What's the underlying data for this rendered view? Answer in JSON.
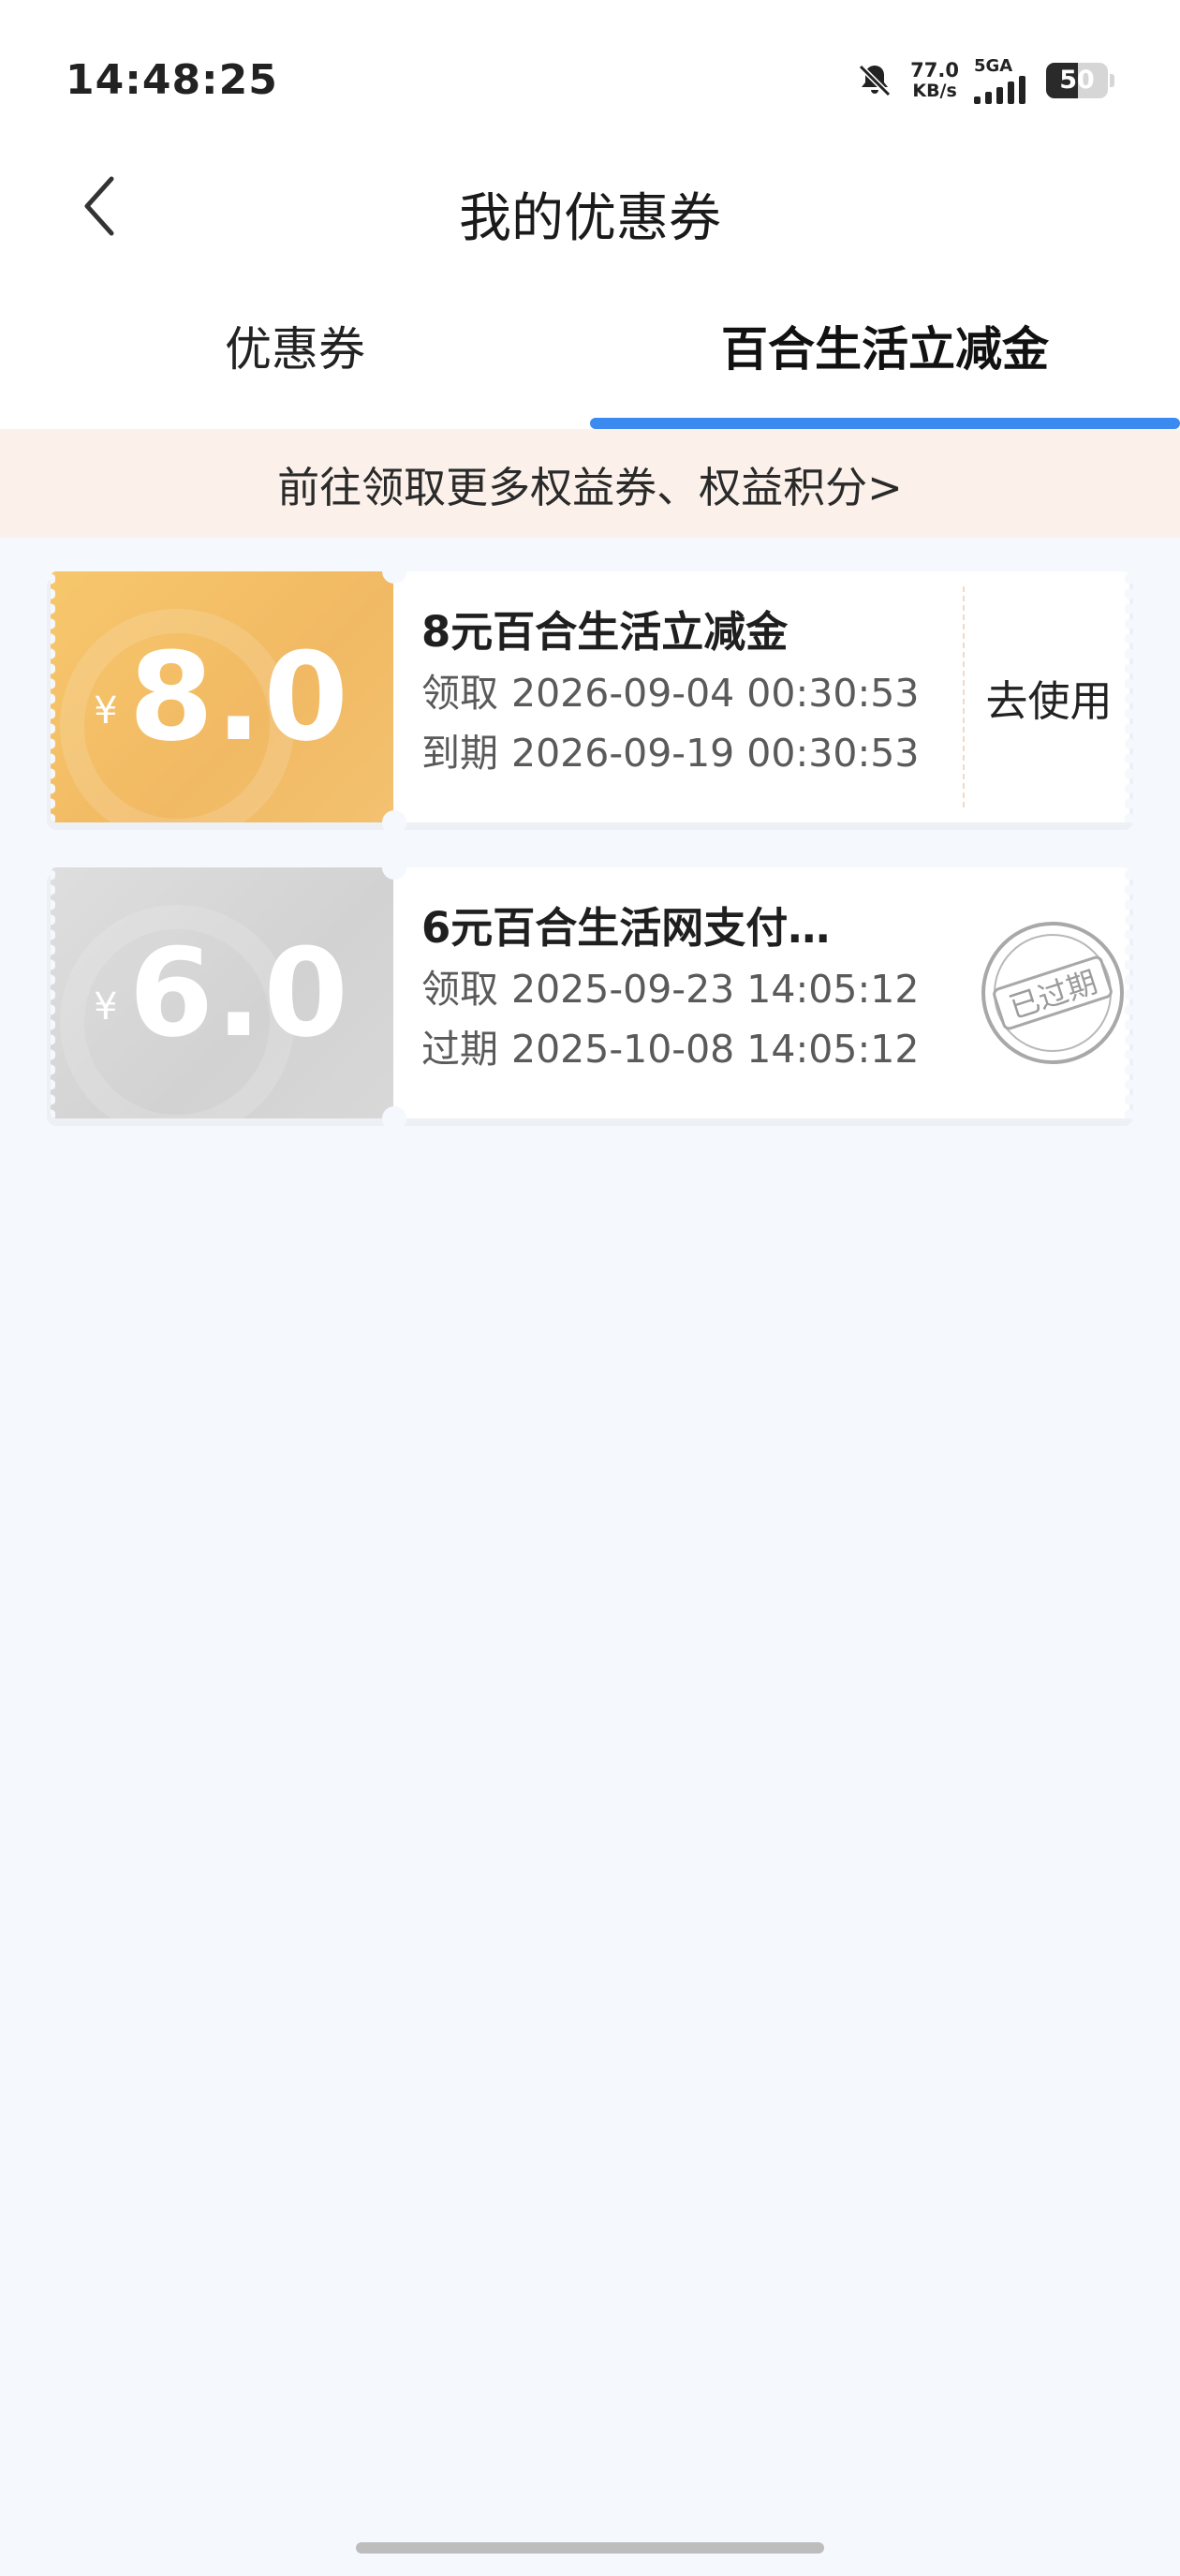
{
  "status_bar": {
    "time": "14:48:25",
    "net_speed_value": "77.0",
    "net_speed_unit": "KB/s",
    "network_type": "5GA",
    "battery_level": "50",
    "icons": [
      "bell-muted-icon",
      "signal-icon",
      "battery-icon"
    ]
  },
  "header": {
    "title": "我的优惠券",
    "back_icon": "chevron-left-icon"
  },
  "tabs": [
    {
      "label": "优惠券",
      "active": false
    },
    {
      "label": "百合生活立减金",
      "active": true
    }
  ],
  "banner": {
    "text": "前往领取更多权益券、权益积分>"
  },
  "coupons": [
    {
      "currency": "¥",
      "amount": "8.0",
      "title": "8元百合生活立减金",
      "claim_label": "领取",
      "claim_time": "2026-09-04 00:30:53",
      "expire_label": "到期",
      "expire_time": "2026-09-19 00:30:53",
      "action": "去使用",
      "status": "active"
    },
    {
      "currency": "¥",
      "amount": "6.0",
      "title": "6元百合生活网支付…",
      "claim_label": "领取",
      "claim_time": "2025-09-23 14:05:12",
      "expire_label": "过期",
      "expire_time": "2025-10-08 14:05:12",
      "stamp": "已过期",
      "status": "expired"
    }
  ],
  "colors": {
    "accent": "#3a8af0",
    "coupon_active": "#f3bf67",
    "coupon_expired": "#d6d6d6",
    "banner_bg": "#fbf1ea",
    "page_bg": "#f5f8fc"
  }
}
